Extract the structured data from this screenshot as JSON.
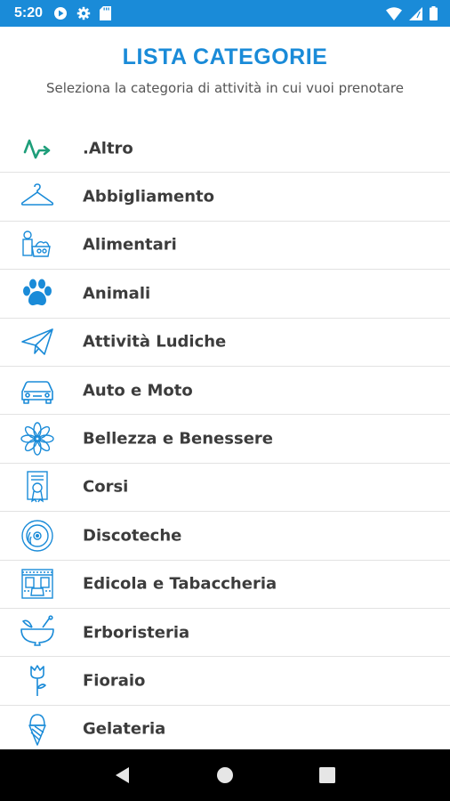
{
  "status_bar": {
    "time": "5:20",
    "left_icons": [
      "play-icon",
      "gear-icon",
      "sd-card-icon"
    ],
    "right_icons": [
      "wifi-icon",
      "signal-icon",
      "battery-icon"
    ]
  },
  "header": {
    "title": "LISTA CATEGORIE",
    "subtitle": "Seleziona la categoria di attività in cui vuoi prenotare"
  },
  "colors": {
    "accent": "#1a8bd8",
    "altro_icon": "#1e9e7a",
    "text": "#3c3c3c",
    "divider": "#e2e2e2"
  },
  "categories": [
    {
      "label": ".Altro",
      "icon": "activity-icon"
    },
    {
      "label": "Abbigliamento",
      "icon": "hanger-icon"
    },
    {
      "label": "Alimentari",
      "icon": "grocery-icon"
    },
    {
      "label": "Animali",
      "icon": "paw-icon"
    },
    {
      "label": "Attività Ludiche",
      "icon": "paper-plane-icon"
    },
    {
      "label": "Auto e Moto",
      "icon": "car-icon"
    },
    {
      "label": "Bellezza e Benessere",
      "icon": "lotus-icon"
    },
    {
      "label": "Corsi",
      "icon": "certificate-icon"
    },
    {
      "label": "Discoteche",
      "icon": "disc-icon"
    },
    {
      "label": "Edicola e Tabaccheria",
      "icon": "newsstand-icon"
    },
    {
      "label": "Erboristeria",
      "icon": "mortar-icon"
    },
    {
      "label": "Fioraio",
      "icon": "rose-icon"
    },
    {
      "label": "Gelateria",
      "icon": "ice-cream-icon"
    }
  ],
  "nav_bar": [
    "back-icon",
    "home-icon",
    "recents-icon"
  ]
}
